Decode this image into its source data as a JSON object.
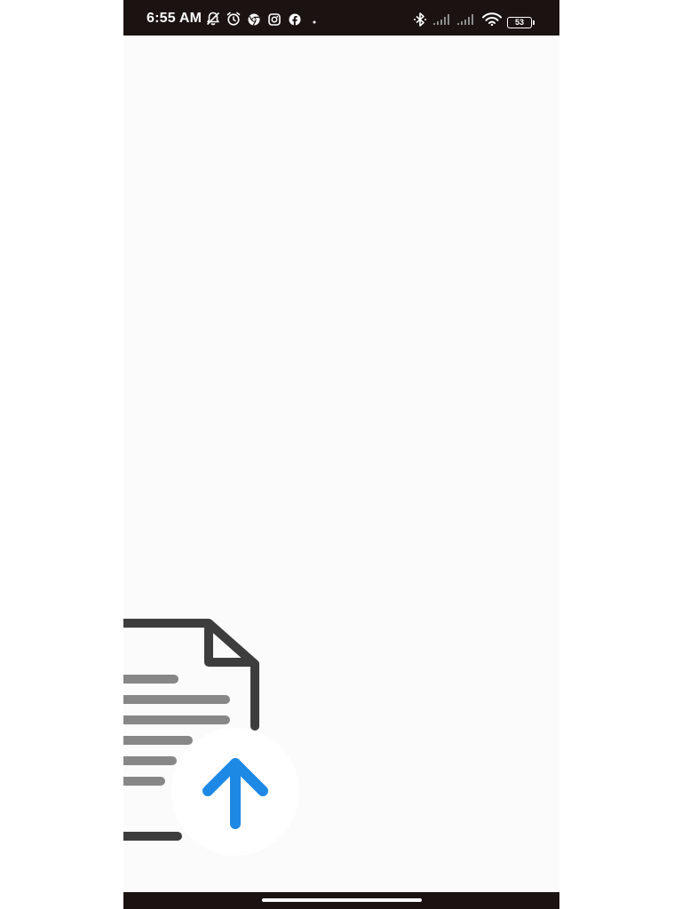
{
  "status_bar": {
    "time": "6:55 AM",
    "battery_level": "53",
    "left_icons": [
      "muted-bell-icon",
      "alarm-icon",
      "chrome-icon",
      "instagram-icon",
      "facebook-icon",
      "notification-dot-icon"
    ],
    "right_icons": [
      "bluetooth-icon",
      "signal-icon",
      "signal-icon",
      "wifi-icon",
      "battery-icon"
    ],
    "background_color": "#1b1311"
  },
  "content": {
    "background_color": "#fbfbfb",
    "illustration": {
      "name": "document-upload-illustration",
      "icons": [
        "document-icon",
        "upload-arrow-icon"
      ],
      "document_color": "#3d3d3d",
      "lines_color": "#878787",
      "arrow_color": "#1e88e5"
    }
  },
  "nav_bar": {
    "background_color": "#1b1311"
  }
}
